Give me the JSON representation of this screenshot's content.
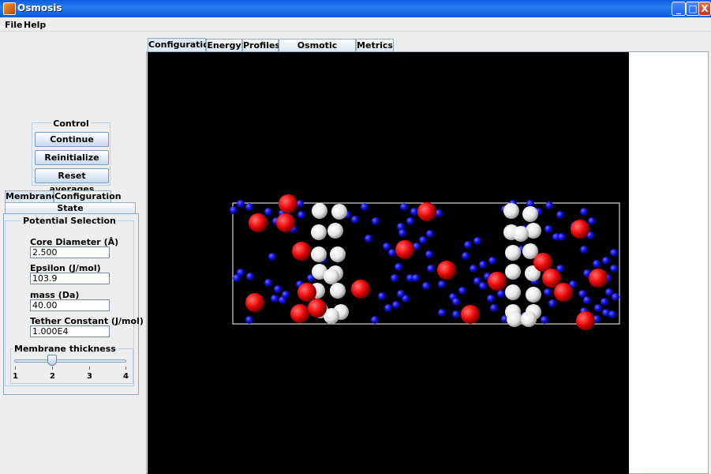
{
  "window": {
    "title": "Osmosis",
    "minimize": "_",
    "maximize": "□",
    "close": "X"
  },
  "menu": [
    "File",
    "Help"
  ],
  "control": {
    "title": "Control",
    "buttons": [
      "Continue",
      "Reinitialize",
      "Reset averages"
    ]
  },
  "left_tabs": [
    "Membrane",
    "Configuration"
  ],
  "left_tab_row2": "State",
  "potential": {
    "title": "Potential Selection",
    "fields": [
      {
        "label": "Core Diameter (Å)",
        "value": "2.500"
      },
      {
        "label": "Epsilon (J/mol)",
        "value": "103.9"
      },
      {
        "label": "mass (Da)",
        "value": "40.00"
      },
      {
        "label": "Tether Constant (J/mol)",
        "value": "1.000E4"
      }
    ]
  },
  "thickness": {
    "title": "Membrane thickness",
    "min": 1,
    "max": 4,
    "value": 2,
    "tick_labels": [
      "1",
      "2",
      "3",
      "4"
    ]
  },
  "main_tabs": [
    "Configuration",
    "Energy",
    "Profiles",
    "Osmotic Pressure",
    "Metrics"
  ],
  "colors": {
    "solvent": "#1010ee",
    "solute": "#ee1010",
    "membrane": "#f4f4f4",
    "background": "#000000",
    "box": "#ffffff"
  }
}
